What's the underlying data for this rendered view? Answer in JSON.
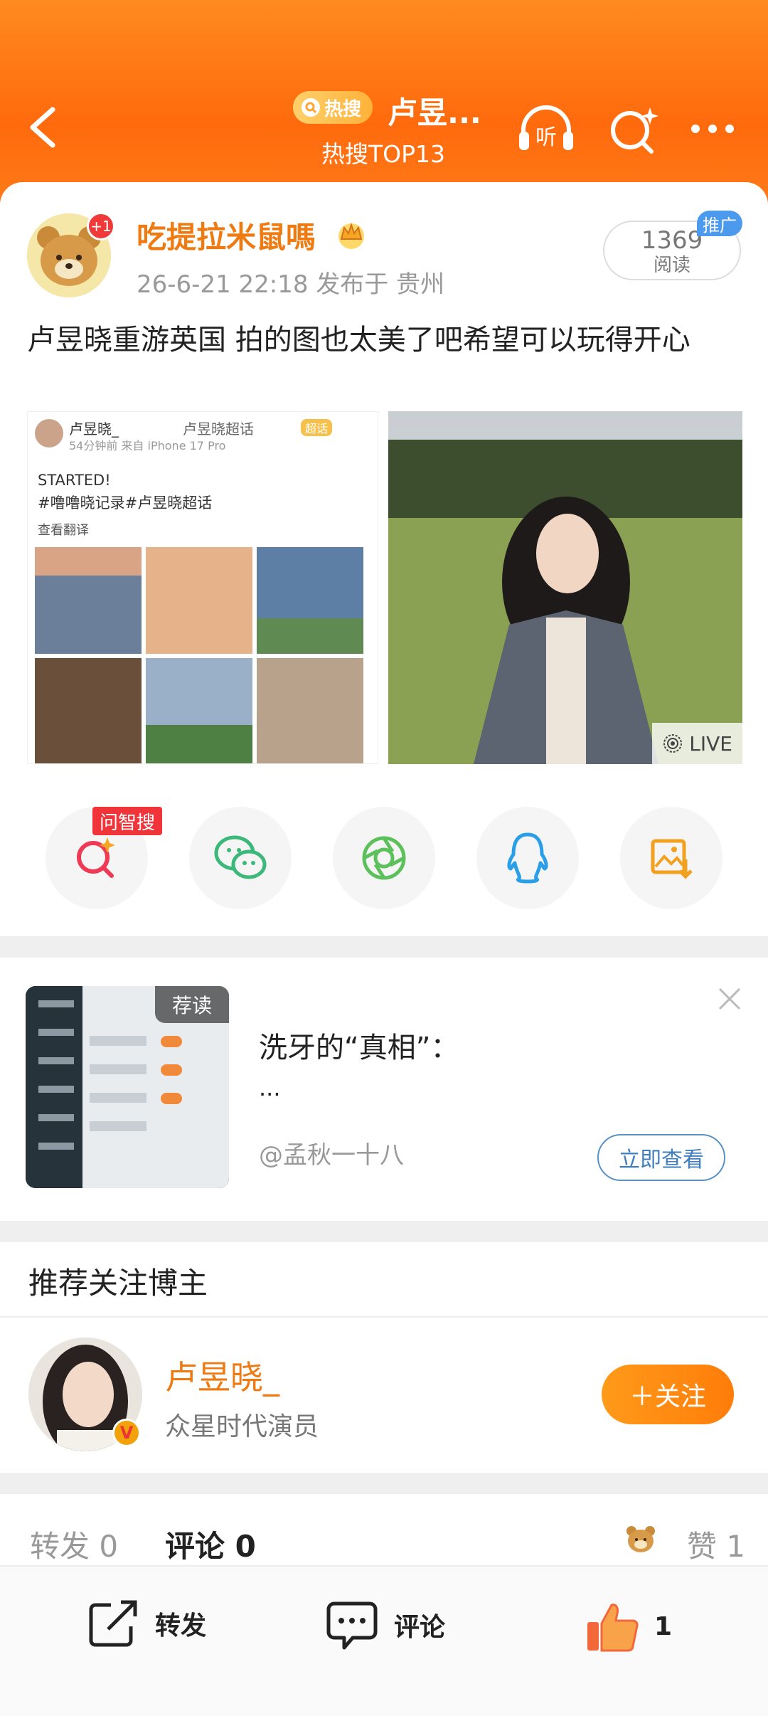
{
  "header": {
    "badge": "热搜",
    "title": "卢昱...",
    "subtitle": "热搜TOP13",
    "listen_label": "听"
  },
  "post": {
    "author": "吃提拉米鼠嗎",
    "author_badge": "+1",
    "meta": "26-6-21 22:18  发布于 贵州",
    "reads_count": "1369",
    "reads_label": "阅读",
    "promo_label": "推广",
    "text": "卢昱晓重游英国 拍的图也太美了吧希望可以玩得开心",
    "live_label": "LIVE",
    "embedded": {
      "name": "卢昱晓_",
      "topic": "卢昱晓超话",
      "source": "54分钟前  来自 iPhone 17 Pro",
      "line1": "STARTED!",
      "line2": "#噜噜晓记录#卢昱晓超话",
      "translate": "查看翻译",
      "tag": "超话"
    }
  },
  "share": {
    "wenzhisou_label": "问智搜"
  },
  "recommend_read": {
    "tag": "荐读",
    "title": "洗牙的“真相”：",
    "dots": "...",
    "author": "@孟秋一十八",
    "button": "立即查看"
  },
  "recommend_follow": {
    "title": "推荐关注博主",
    "name": "卢昱晓_",
    "desc": "众星时代演员",
    "follow_btn": "＋关注"
  },
  "stats": {
    "repost": "转发 0",
    "comment": "评论 0",
    "like": "赞 1"
  },
  "bottom_bar": {
    "repost": "转发",
    "comment": "评论",
    "like_count": "1"
  },
  "colors": {
    "header_orange": "#ff6a0d",
    "accent_orange": "#f07a12",
    "link_blue": "#3f7fc0"
  }
}
